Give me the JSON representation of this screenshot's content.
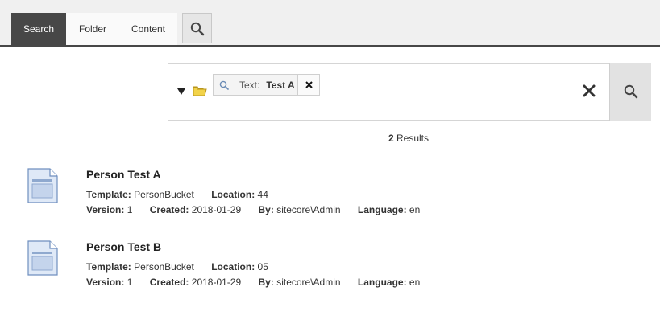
{
  "tabs": [
    {
      "label": "Search",
      "active": true
    },
    {
      "label": "Folder",
      "active": false
    },
    {
      "label": "Content",
      "active": false
    }
  ],
  "tab_search_icon": "magnifier-icon",
  "search": {
    "filter_chip": {
      "label": "Text:",
      "value": "Test A"
    },
    "clear_icon": "close-x-icon",
    "go_icon": "magnifier-icon"
  },
  "results": {
    "count": "2",
    "count_label": "Results",
    "items": [
      {
        "title": "Person Test A",
        "template_label": "Template:",
        "template": "PersonBucket",
        "location_label": "Location:",
        "location": "44",
        "version_label": "Version:",
        "version": "1",
        "created_label": "Created:",
        "created": "2018-01-29",
        "by_label": "By:",
        "by": "sitecore\\Admin",
        "language_label": "Language:",
        "language": "en"
      },
      {
        "title": "Person Test B",
        "template_label": "Template:",
        "template": "PersonBucket",
        "location_label": "Location:",
        "location": "05",
        "version_label": "Version:",
        "version": "1",
        "created_label": "Created:",
        "created": "2018-01-29",
        "by_label": "By:",
        "by": "sitecore\\Admin",
        "language_label": "Language:",
        "language": "en"
      }
    ]
  },
  "colors": {
    "active_tab": "#474747",
    "folder": "#f2d34a"
  }
}
